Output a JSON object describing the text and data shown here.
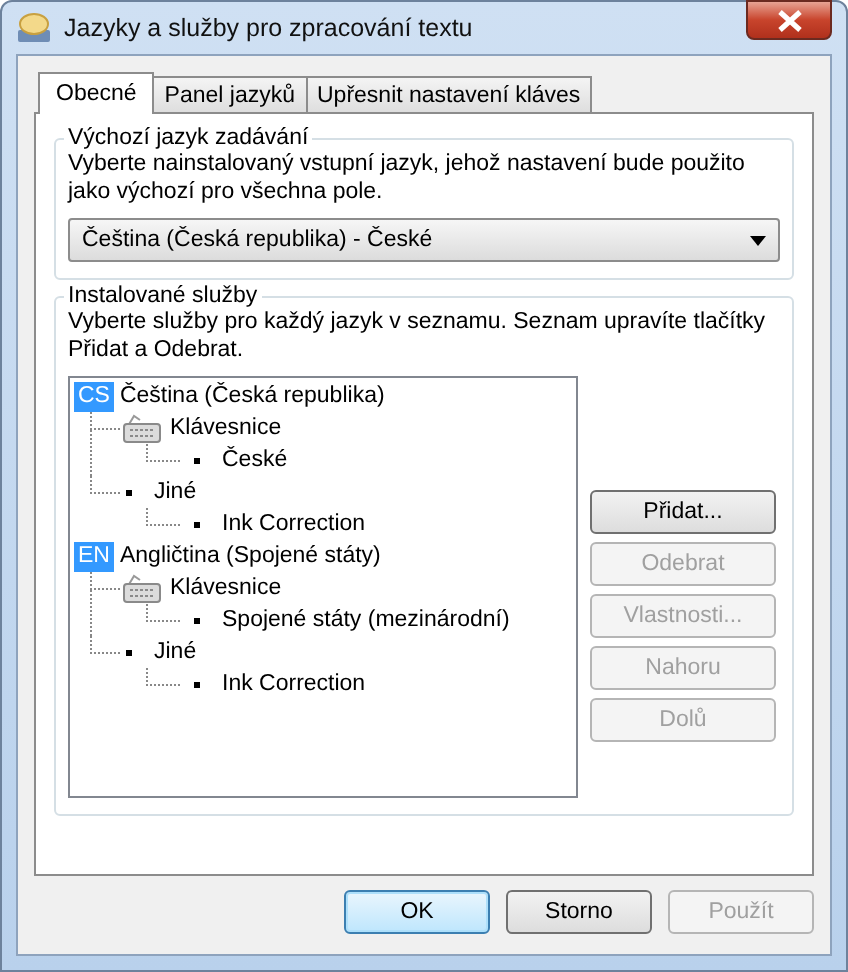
{
  "window": {
    "title": "Jazyky a služby pro zpracování textu"
  },
  "tabs": [
    {
      "label": "Obecné",
      "selected": true
    },
    {
      "label": "Panel jazyků",
      "selected": false
    },
    {
      "label": "Upřesnit nastavení kláves",
      "selected": false
    }
  ],
  "input_language": {
    "label": "Výchozí jazyk zadávání",
    "description": "Vyberte nainstalovaný vstupní jazyk, jehož nastavení bude použito jako výchozí pro všechna pole.",
    "dropdown": {
      "value": "Čeština (Česká republika) - České"
    }
  },
  "services": {
    "label": "Instalované služby",
    "description": "Vyberte služby pro každý jazyk v seznamu. Seznam upravíte tlačítky Přidat a Odebrat.",
    "tree": [
      {
        "badge": "CS",
        "label": "Čeština (Česká republika)",
        "children": [
          {
            "kind": "keyboard",
            "label": "Klávesnice",
            "children": [
              {
                "label": "České"
              }
            ]
          },
          {
            "kind": "other",
            "label": "Jiné",
            "children": [
              {
                "label": "Ink Correction"
              }
            ]
          }
        ]
      },
      {
        "badge": "EN",
        "label": "Angličtina (Spojené státy)",
        "children": [
          {
            "kind": "keyboard",
            "label": "Klávesnice",
            "children": [
              {
                "label": "Spojené státy (mezinárodní)"
              }
            ]
          },
          {
            "kind": "other",
            "label": "Jiné",
            "children": [
              {
                "label": "Ink Correction"
              }
            ]
          }
        ]
      }
    ],
    "buttons": [
      {
        "label": "Přidat...",
        "disabled": false
      },
      {
        "label": "Odebrat",
        "disabled": true
      },
      {
        "label": "Vlastnosti...",
        "disabled": true
      },
      {
        "label": "Nahoru",
        "disabled": true
      },
      {
        "label": "Dolů",
        "disabled": true
      }
    ]
  },
  "buttons": [
    {
      "label": "OK",
      "disabled": false,
      "default": true
    },
    {
      "label": "Storno",
      "disabled": false,
      "default": false
    },
    {
      "label": "Použít",
      "disabled": true,
      "default": false
    }
  ]
}
